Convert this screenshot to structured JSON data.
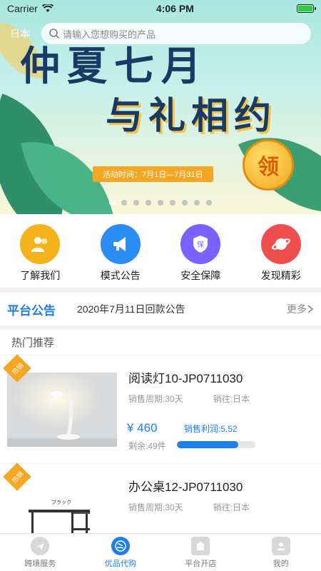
{
  "status_bar": {
    "carrier": "Carrier",
    "time": "4:06 PM"
  },
  "banner": {
    "country": "日本",
    "search_placeholder": "请输入您想购买的产品",
    "title_line1": "仲夏七月",
    "title_line2": "与礼相约",
    "activity": "活动时间：7月1日—7月31日",
    "coin_text": "领",
    "dots_count": 9,
    "active_dot": 0
  },
  "quick_nav": [
    {
      "label": "了解我们",
      "icon": "people-icon",
      "color": "#f5b21b"
    },
    {
      "label": "模式公告",
      "icon": "megaphone-icon",
      "color": "#2a8df2"
    },
    {
      "label": "安全保障",
      "icon": "shield-icon",
      "color": "#7b61ff"
    },
    {
      "label": "发现精彩",
      "icon": "planet-icon",
      "color": "#f04e4e"
    }
  ],
  "notice": {
    "tag": "平台公告",
    "message": "2020年7月11日回款公告",
    "more": "更多"
  },
  "hot": {
    "header": "热门推荐",
    "products": [
      {
        "badge": "热销",
        "name": "阅读灯10-JP0711030",
        "period": "销售周期:30天",
        "sold_in": "销往:日本",
        "price": "¥ 460",
        "profit": "销售利润:5.52",
        "stock": "剩余:49件",
        "progress": 0.78,
        "image": "lamp-image"
      },
      {
        "badge": "热销",
        "name": "办公桌12-JP0711030",
        "period": "销售周期:30天",
        "sold_in": "销往:日本",
        "price": "",
        "profit": "",
        "stock": "",
        "progress": 0,
        "image": "desk-image",
        "image_caption": "ブラック"
      }
    ]
  },
  "tabbar": [
    {
      "label": "跨境服务",
      "icon": "globe-plane-icon",
      "active": false
    },
    {
      "label": "优品代购",
      "icon": "earth-icon",
      "active": true
    },
    {
      "label": "平台开店",
      "icon": "shop-icon",
      "active": false
    },
    {
      "label": "我的",
      "icon": "user-icon",
      "active": false
    }
  ],
  "colors": {
    "accent": "#1e7fe8",
    "badge": "#f5a623"
  }
}
